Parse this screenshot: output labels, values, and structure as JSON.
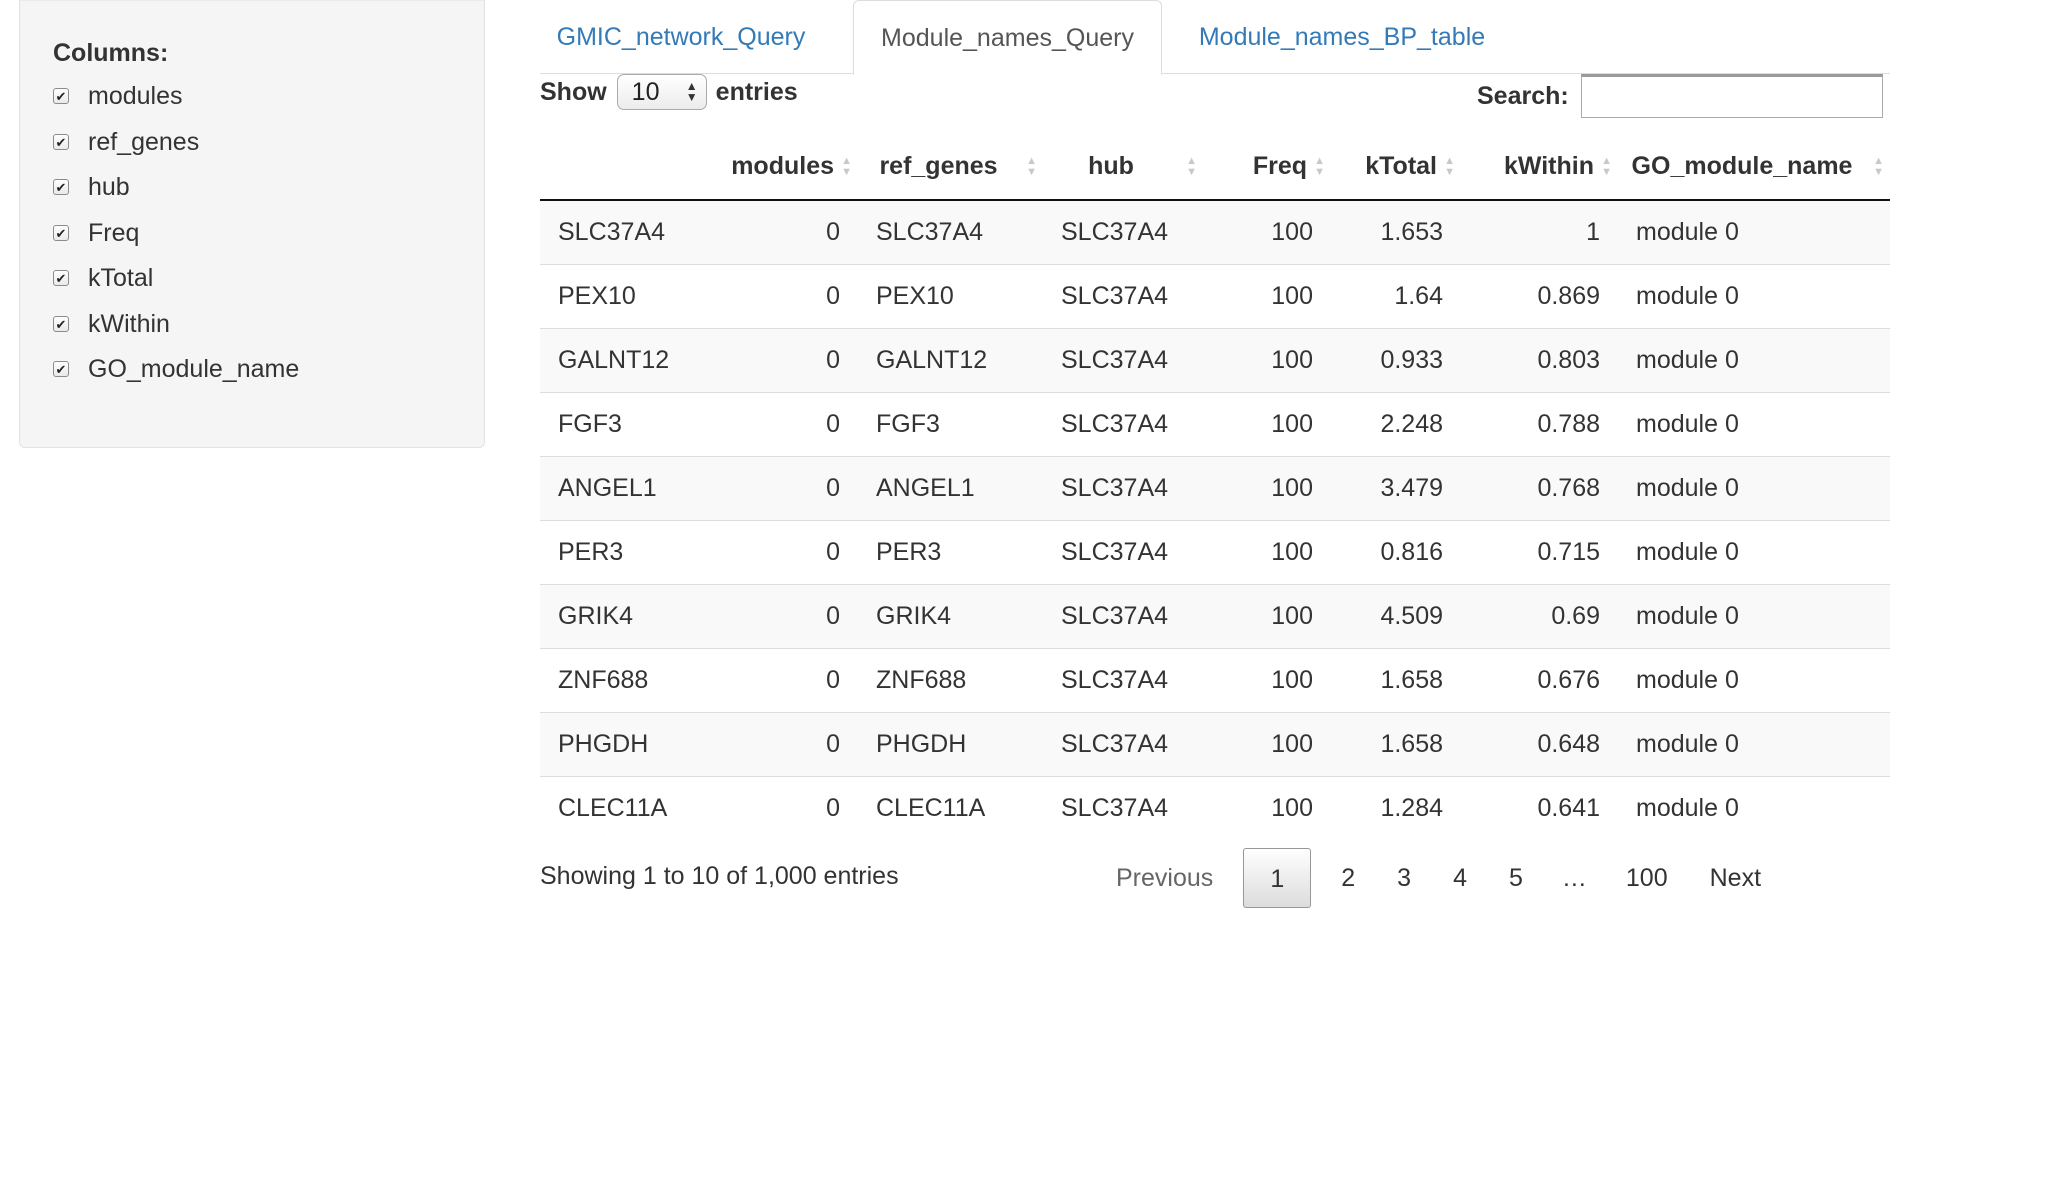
{
  "sidebar": {
    "title": "Columns:",
    "options": [
      {
        "label": "modules",
        "checked": true
      },
      {
        "label": "ref_genes",
        "checked": true
      },
      {
        "label": "hub",
        "checked": true
      },
      {
        "label": "Freq",
        "checked": true
      },
      {
        "label": "kTotal",
        "checked": true
      },
      {
        "label": "kWithin",
        "checked": true
      },
      {
        "label": "GO_module_name",
        "checked": true
      }
    ]
  },
  "tabs": [
    {
      "label": "GMIC_network_Query",
      "active": false
    },
    {
      "label": "Module_names_Query",
      "active": true
    },
    {
      "label": "Module_names_BP_table",
      "active": false
    }
  ],
  "length": {
    "show_label": "Show",
    "value": "10",
    "entries_label": "entries"
  },
  "search": {
    "label": "Search:",
    "value": "",
    "placeholder": ""
  },
  "table": {
    "headers": [
      "",
      "modules",
      "ref_genes",
      "hub",
      "Freq",
      "kTotal",
      "kWithin",
      "GO_module_name"
    ],
    "rows": [
      [
        "SLC37A4",
        "0",
        "SLC37A4",
        "SLC37A4",
        "100",
        "1.653",
        "1",
        "module 0"
      ],
      [
        "PEX10",
        "0",
        "PEX10",
        "SLC37A4",
        "100",
        "1.64",
        "0.869",
        "module 0"
      ],
      [
        "GALNT12",
        "0",
        "GALNT12",
        "SLC37A4",
        "100",
        "0.933",
        "0.803",
        "module 0"
      ],
      [
        "FGF3",
        "0",
        "FGF3",
        "SLC37A4",
        "100",
        "2.248",
        "0.788",
        "module 0"
      ],
      [
        "ANGEL1",
        "0",
        "ANGEL1",
        "SLC37A4",
        "100",
        "3.479",
        "0.768",
        "module 0"
      ],
      [
        "PER3",
        "0",
        "PER3",
        "SLC37A4",
        "100",
        "0.816",
        "0.715",
        "module 0"
      ],
      [
        "GRIK4",
        "0",
        "GRIK4",
        "SLC37A4",
        "100",
        "4.509",
        "0.69",
        "module 0"
      ],
      [
        "ZNF688",
        "0",
        "ZNF688",
        "SLC37A4",
        "100",
        "1.658",
        "0.676",
        "module 0"
      ],
      [
        "PHGDH",
        "0",
        "PHGDH",
        "SLC37A4",
        "100",
        "1.658",
        "0.648",
        "module 0"
      ],
      [
        "CLEC11A",
        "0",
        "CLEC11A",
        "SLC37A4",
        "100",
        "1.284",
        "0.641",
        "module 0"
      ]
    ]
  },
  "footer": {
    "info": "Showing 1 to 10 of 1,000 entries",
    "previous": "Previous",
    "pages": [
      "1",
      "2",
      "3",
      "4",
      "5",
      "…",
      "100"
    ],
    "current_page": "1",
    "next": "Next"
  },
  "colors": {
    "link": "#337ab7",
    "sidebar_bg": "#f5f5f5",
    "row_stripe": "#f9f9f9"
  }
}
